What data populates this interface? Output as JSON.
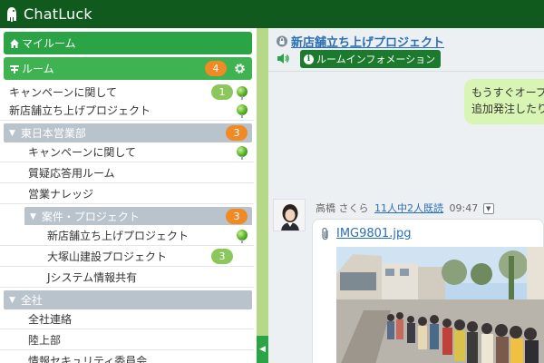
{
  "app": {
    "name": "ChatLuck"
  },
  "sidebar": {
    "my_room": "マイルーム",
    "room": {
      "label": "ルーム",
      "badge": "4"
    },
    "rooms": [
      {
        "label": "キャンペーンに関して",
        "badge": "1",
        "online": true
      },
      {
        "label": "新店舗立ち上げプロジェクト",
        "online": true,
        "selected": true
      }
    ],
    "groups": [
      {
        "name": "東日本営業部",
        "badge": "3",
        "items": [
          {
            "label": "キャンペーンに関して",
            "online": true
          },
          {
            "label": "質疑応答用ルーム"
          },
          {
            "label": "営業ナレッジ"
          }
        ],
        "subgroup": {
          "name": "案件・プロジェクト",
          "badge": "3",
          "items": [
            {
              "label": "新店舗立ち上げプロジェクト",
              "online": true,
              "selected": true
            },
            {
              "label": "大塚山建設プロジェクト",
              "badge": "3"
            },
            {
              "label": "Jシステム情報共有"
            }
          ]
        }
      },
      {
        "name": "全社",
        "items": [
          {
            "label": "全社連絡"
          },
          {
            "label": "陸上部"
          },
          {
            "label": "情報セキュリティ委員会"
          }
        ]
      }
    ]
  },
  "main": {
    "room_title": "新店舗立ち上げプロジェクト",
    "room_info_button": "ルームインフォメーション",
    "my_message_lines": [
      "もうすぐオープ",
      "追加発注したり"
    ],
    "message": {
      "sender": "高橋 さくら",
      "read_status": "11人中2人既読",
      "time": "09:47",
      "attachment": "IMG9801.jpg"
    }
  },
  "colors": {
    "header_bg": "#0f5a1c",
    "accent_green": "#2aa444",
    "badge_orange": "#f08a24",
    "link_blue": "#2a6fb5"
  }
}
